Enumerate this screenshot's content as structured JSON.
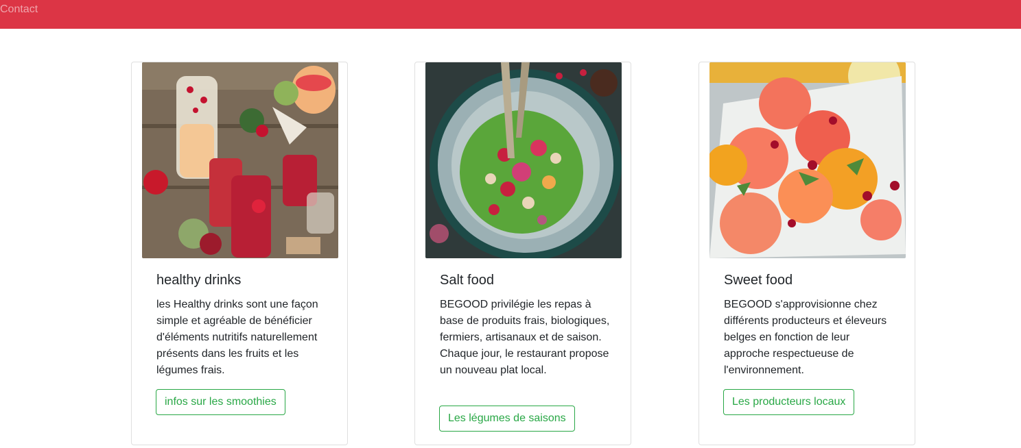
{
  "navbar": {
    "contact_label": "Contact",
    "background_color": "#dc3545"
  },
  "cards": [
    {
      "image_alt": "healthy drinks photo",
      "title": "healthy drinks",
      "text": "les Healthy drinks sont une façon simple et agréable de bénéficier d'éléments nutritifs naturellement présents dans les fruits et les légumes frais.",
      "button_label": "infos sur les smoothies"
    },
    {
      "image_alt": "salt food photo",
      "title": "Salt food",
      "text": "BEGOOD privilégie les repas à base de produits frais, biologiques, fermiers, artisanaux et de saison. Chaque jour, le restaurant propose un nouveau plat local.",
      "button_label": "Les légumes de saisons"
    },
    {
      "image_alt": "sweet food photo",
      "title": "Sweet food",
      "text": "BEGOOD s'approvisionne chez différents producteurs et éleveurs belges en fonction de leur approche respectueuse de l'environnement.",
      "button_label": "Les producteurs locaux"
    }
  ],
  "colors": {
    "button_outline": "#28a745",
    "card_border": "#dfdfdf"
  }
}
